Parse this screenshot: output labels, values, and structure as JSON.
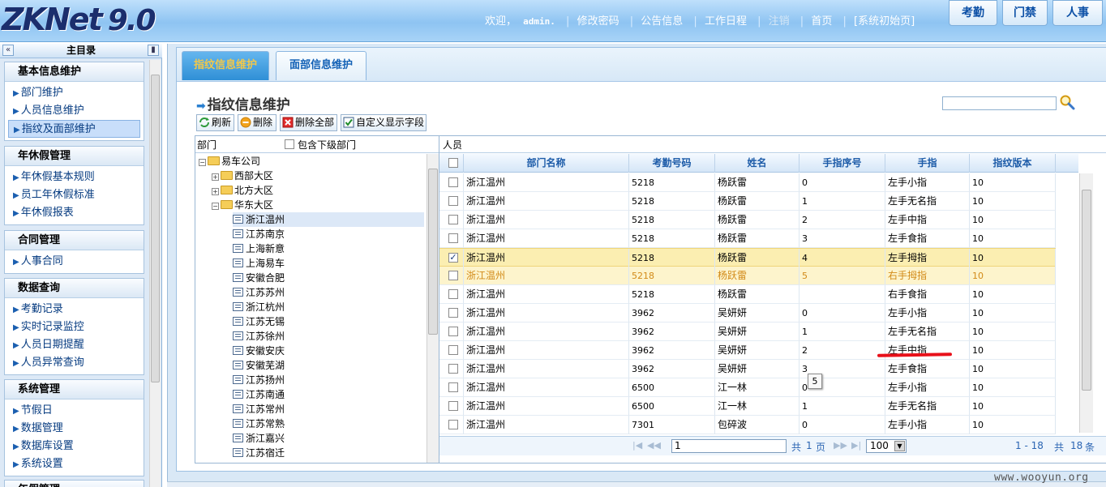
{
  "header": {
    "logo": "ZKNet",
    "version": "9.0",
    "welcome": "欢迎，",
    "user": "admin.",
    "links": [
      "修改密码",
      "公告信息",
      "工作日程",
      "注销",
      "首页",
      "[系统初始页]"
    ],
    "modules": [
      "考勤",
      "门禁",
      "人事"
    ]
  },
  "sidebar": {
    "title": "主目录",
    "groups": [
      {
        "title": "基本信息维护",
        "items": [
          "部门维护",
          "人员信息维护",
          "指纹及面部维护"
        ]
      },
      {
        "title": "年休假管理",
        "items": [
          "年休假基本规则",
          "员工年休假标准",
          "年休假报表"
        ]
      },
      {
        "title": "合同管理",
        "items": [
          "人事合同"
        ]
      },
      {
        "title": "数据查询",
        "items": [
          "考勤记录",
          "实时记录监控",
          "人员日期提醒",
          "人员异常查询"
        ]
      },
      {
        "title": "系统管理",
        "items": [
          "节假日",
          "数据管理",
          "数据库设置",
          "系统设置"
        ]
      },
      {
        "title": "年假管理",
        "items": []
      }
    ]
  },
  "tabs": [
    "指纹信息维护",
    "面部信息维护"
  ],
  "page_title": "指纹信息维护",
  "search": {
    "value": ""
  },
  "toolbar": {
    "refresh": "刷新",
    "delete": "删除",
    "delete_all": "删除全部",
    "custom_fields": "自定义显示字段"
  },
  "dept": {
    "label": "部门",
    "include_sub": "包含下级部门",
    "tree": {
      "root": "易车公司",
      "regions": [
        "西部大区",
        "北方大区",
        "华东大区"
      ],
      "branches": [
        "浙江温州",
        "江苏南京",
        "上海新意",
        "上海易车",
        "安徽合肥",
        "江苏苏州",
        "浙江杭州",
        "江苏无锡",
        "江苏徐州",
        "安徽安庆",
        "安徽芜湖",
        "江苏扬州",
        "江苏南通",
        "江苏常州",
        "江苏常熟",
        "浙江嘉兴",
        "江苏宿迁"
      ]
    }
  },
  "grid": {
    "label": "人员",
    "columns": [
      "部门名称",
      "考勤号码",
      "姓名",
      "手指序号",
      "手指",
      "指纹版本"
    ],
    "rows": [
      [
        "浙江温州",
        "5218",
        "杨跃雷",
        "0",
        "左手小指",
        "10"
      ],
      [
        "浙江温州",
        "5218",
        "杨跃雷",
        "1",
        "左手无名指",
        "10"
      ],
      [
        "浙江温州",
        "5218",
        "杨跃雷",
        "2",
        "左手中指",
        "10"
      ],
      [
        "浙江温州",
        "5218",
        "杨跃雷",
        "3",
        "左手食指",
        "10"
      ],
      [
        "浙江温州",
        "5218",
        "杨跃雷",
        "4",
        "左手拇指",
        "10"
      ],
      [
        "浙江温州",
        "5218",
        "杨跃雷",
        "5",
        "右手拇指",
        "10"
      ],
      [
        "浙江温州",
        "5218",
        "杨跃雷",
        "",
        "右手食指",
        "10"
      ],
      [
        "浙江温州",
        "3962",
        "吴妍妍",
        "0",
        "左手小指",
        "10"
      ],
      [
        "浙江温州",
        "3962",
        "吴妍妍",
        "1",
        "左手无名指",
        "10"
      ],
      [
        "浙江温州",
        "3962",
        "吴妍妍",
        "2",
        "左手中指",
        "10"
      ],
      [
        "浙江温州",
        "3962",
        "吴妍妍",
        "3",
        "左手食指",
        "10"
      ],
      [
        "浙江温州",
        "6500",
        "江一林",
        "0",
        "左手小指",
        "10"
      ],
      [
        "浙江温州",
        "6500",
        "江一林",
        "1",
        "左手无名指",
        "10"
      ],
      [
        "浙江温州",
        "7301",
        "包碎波",
        "0",
        "左手小指",
        "10"
      ]
    ],
    "tooltip": "5"
  },
  "pager": {
    "page": "1",
    "of_prefix": "共",
    "total_pages": "1",
    "page_suffix": "页",
    "page_size": "100",
    "range": "1 - 18",
    "total_prefix": "共",
    "total": "18",
    "total_suffix": "条"
  },
  "watermark": "www.wooyun.org"
}
